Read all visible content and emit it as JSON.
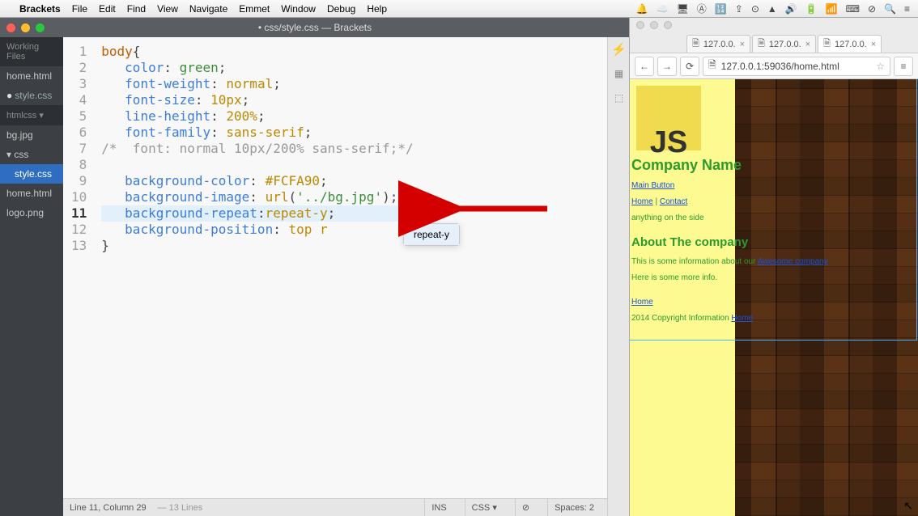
{
  "menubar": {
    "app": "Brackets",
    "items": [
      "File",
      "Edit",
      "Find",
      "View",
      "Navigate",
      "Emmet",
      "Window",
      "Debug",
      "Help"
    ],
    "status_icons": [
      "🔔",
      "☁️",
      "🖥",
      "Ⓐ",
      "🔢",
      "⇪",
      "⊙",
      "▲",
      "🔊",
      "🔋",
      "📶",
      "⌨",
      "⊘",
      "🔍",
      "≡"
    ]
  },
  "brackets": {
    "title": "• css/style.css — Brackets",
    "working_files_label": "Working Files",
    "working_files": [
      {
        "name": "home.html",
        "dirty": false
      },
      {
        "name": "style.css",
        "dirty": true
      }
    ],
    "project_label": "htmlcss ▾",
    "tree": [
      {
        "name": "bg.jpg",
        "indent": 0
      },
      {
        "name": "css",
        "indent": 0,
        "folder": true,
        "open": true
      },
      {
        "name": "style.css",
        "indent": 1,
        "selected": true
      },
      {
        "name": "home.html",
        "indent": 0
      },
      {
        "name": "logo.png",
        "indent": 0
      }
    ],
    "code_lines": [
      [
        {
          "t": "body",
          "c": "sel"
        },
        {
          "t": "{",
          "c": "plain"
        }
      ],
      [
        {
          "t": "   ",
          "c": "plain"
        },
        {
          "t": "color",
          "c": "prop"
        },
        {
          "t": ": ",
          "c": "plain"
        },
        {
          "t": "green",
          "c": "kw"
        },
        {
          "t": ";",
          "c": "plain"
        }
      ],
      [
        {
          "t": "   ",
          "c": "plain"
        },
        {
          "t": "font-weight",
          "c": "prop"
        },
        {
          "t": ": ",
          "c": "plain"
        },
        {
          "t": "normal",
          "c": "val"
        },
        {
          "t": ";",
          "c": "plain"
        }
      ],
      [
        {
          "t": "   ",
          "c": "plain"
        },
        {
          "t": "font-size",
          "c": "prop"
        },
        {
          "t": ": ",
          "c": "plain"
        },
        {
          "t": "10px",
          "c": "val"
        },
        {
          "t": ";",
          "c": "plain"
        }
      ],
      [
        {
          "t": "   ",
          "c": "plain"
        },
        {
          "t": "line-height",
          "c": "prop"
        },
        {
          "t": ": ",
          "c": "plain"
        },
        {
          "t": "200%",
          "c": "val"
        },
        {
          "t": ";",
          "c": "plain"
        }
      ],
      [
        {
          "t": "   ",
          "c": "plain"
        },
        {
          "t": "font-family",
          "c": "prop"
        },
        {
          "t": ": ",
          "c": "plain"
        },
        {
          "t": "sans-serif",
          "c": "val"
        },
        {
          "t": ";",
          "c": "plain"
        }
      ],
      [
        {
          "t": "/*  font: normal 10px/200% sans-serif;*/",
          "c": "cm"
        }
      ],
      [
        {
          "t": "",
          "c": "plain"
        }
      ],
      [
        {
          "t": "   ",
          "c": "plain"
        },
        {
          "t": "background-color",
          "c": "prop"
        },
        {
          "t": ": ",
          "c": "plain"
        },
        {
          "t": "#FCFA90",
          "c": "val"
        },
        {
          "t": ";",
          "c": "plain"
        }
      ],
      [
        {
          "t": "   ",
          "c": "plain"
        },
        {
          "t": "background-image",
          "c": "prop"
        },
        {
          "t": ": ",
          "c": "plain"
        },
        {
          "t": "url",
          "c": "val"
        },
        {
          "t": "(",
          "c": "plain"
        },
        {
          "t": "'../bg.jpg'",
          "c": "str"
        },
        {
          "t": ")",
          "c": "plain"
        },
        {
          "t": ";",
          "c": "plain"
        }
      ],
      [
        {
          "t": "   ",
          "c": "plain"
        },
        {
          "t": "background-repeat",
          "c": "prop"
        },
        {
          "t": ":",
          "c": "plain"
        },
        {
          "t": "repeat-y",
          "c": "val"
        },
        {
          "t": ";",
          "c": "plain"
        }
      ],
      [
        {
          "t": "   ",
          "c": "plain"
        },
        {
          "t": "background-position",
          "c": "prop"
        },
        {
          "t": ": ",
          "c": "plain"
        },
        {
          "t": "top r",
          "c": "val"
        }
      ],
      [
        {
          "t": "}",
          "c": "plain"
        }
      ]
    ],
    "active_line": 11,
    "hint": "repeat-y",
    "status": {
      "cursor": "Line 11, Column 29",
      "lines": "— 13 Lines",
      "ins": "INS",
      "lang": "CSS ▾",
      "lint": "⊘",
      "spaces": "Spaces: 2"
    }
  },
  "browser": {
    "tabs": [
      "127.0.0.",
      "127.0.0.",
      "127.0.0."
    ],
    "active_tab": 2,
    "url": "127.0.0.1:59036/home.html",
    "page": {
      "logo": "JS",
      "company": "Company Name",
      "main_button": "Main Button",
      "home": "Home",
      "contact": "Contact",
      "sidebar_text": "anything on the side",
      "about_title": "About The company",
      "about_p1_pre": "This is some information about our ",
      "about_link": "Awesome company",
      "about_p2": "Here is some more info.",
      "footer_home": "Home",
      "copyright": "2014 Copyright Information ",
      "footer_home2": "Home"
    }
  }
}
